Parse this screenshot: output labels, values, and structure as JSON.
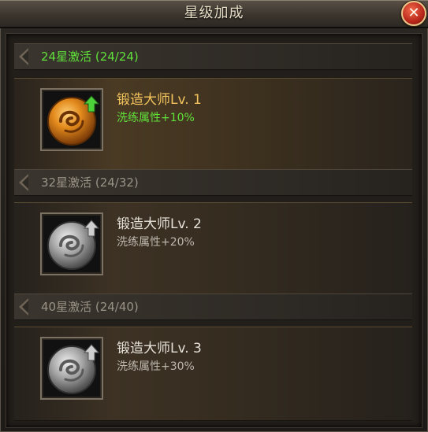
{
  "title": "星级加成",
  "close_icon": "close-icon",
  "tiers": [
    {
      "header": "24星激活 (24/24)",
      "active": true,
      "skill_name": "锻造大师Lv. 1",
      "skill_desc": "洗练属性+10%",
      "icon": "forge-master-emblem-gold"
    },
    {
      "header": "32星激活 (24/32)",
      "active": false,
      "skill_name": "锻造大师Lv. 2",
      "skill_desc": "洗练属性+20%",
      "icon": "forge-master-emblem-gray"
    },
    {
      "header": "40星激活 (24/40)",
      "active": false,
      "skill_name": "锻造大师Lv. 3",
      "skill_desc": "洗练属性+30%",
      "icon": "forge-master-emblem-gray"
    }
  ],
  "colors": {
    "active_green": "#5fe13a",
    "gold_title": "#f2c35c",
    "inactive_gray": "#9a9387"
  }
}
